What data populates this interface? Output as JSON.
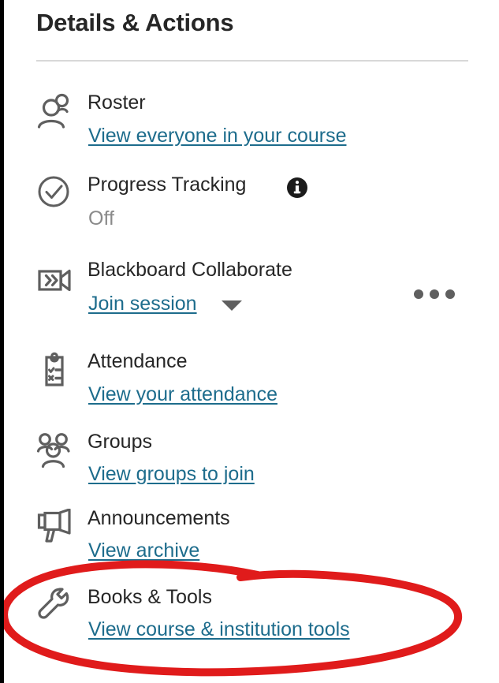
{
  "panel": {
    "title": "Details & Actions"
  },
  "items": [
    {
      "icon": "roster-people-icon",
      "title": "Roster",
      "link": "View everyone in your course"
    },
    {
      "icon": "check-circle-icon",
      "title": "Progress Tracking",
      "info_icon": "info-circle-icon",
      "status": "Off"
    },
    {
      "icon": "video-camera-icon",
      "title": "Blackboard Collaborate",
      "link": "Join session",
      "caret_icon": "chevron-down-icon",
      "menu_icon": "overflow-menu-icon"
    },
    {
      "icon": "clipboard-checklist-icon",
      "title": "Attendance",
      "link": "View your attendance"
    },
    {
      "icon": "groups-people-icon",
      "title": "Groups",
      "link": "View groups to join"
    },
    {
      "icon": "megaphone-icon",
      "title": "Announcements",
      "link": "View archive"
    },
    {
      "icon": "wrench-icon",
      "title": "Books & Tools",
      "link": "View course & institution tools"
    }
  ],
  "annotation": {
    "shape": "red-ellipse-highlight",
    "color": "#e01b1b",
    "targets": "Books & Tools"
  },
  "colors": {
    "link": "#1d6c8c",
    "text": "#262626",
    "muted": "#8a8a8a",
    "icon": "#5f5f5f",
    "annotation": "#e01b1b",
    "divider": "#d8d8d8"
  }
}
